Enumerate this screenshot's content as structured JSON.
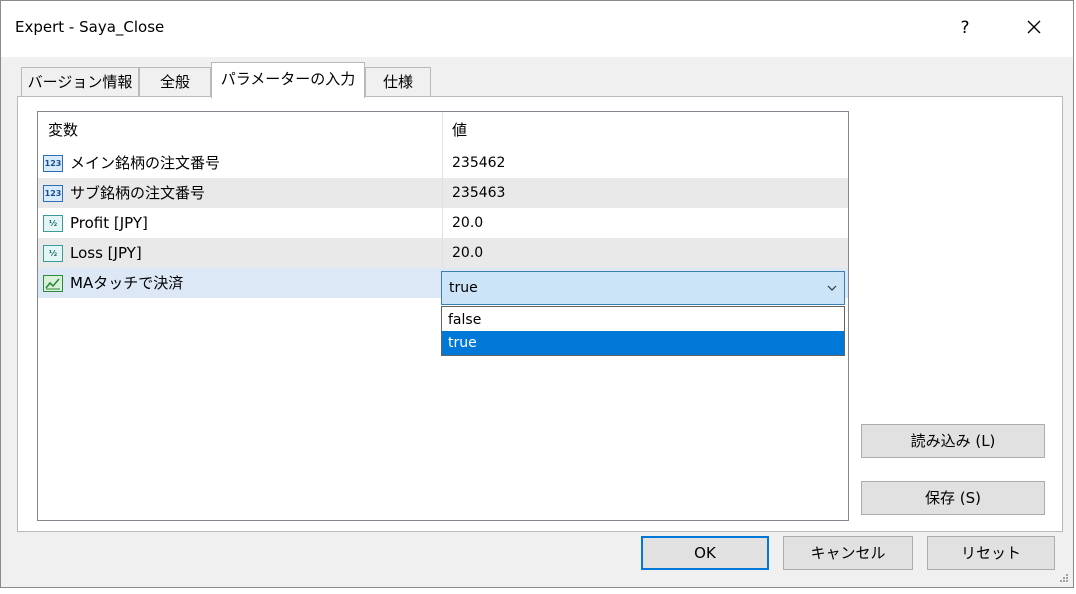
{
  "window": {
    "title": "Expert - Saya_Close",
    "help_label": "?",
    "close_label": "✕"
  },
  "tabs": [
    {
      "label": "バージョン情報"
    },
    {
      "label": "全般"
    },
    {
      "label": "パラメーターの入力"
    },
    {
      "label": "仕様"
    }
  ],
  "active_tab": "パラメーターの入力",
  "grid": {
    "headers": {
      "variable": "変数",
      "value": "値"
    },
    "rows": [
      {
        "icon": "123",
        "name": "メイン銘柄の注文番号",
        "value": "235462"
      },
      {
        "icon": "123",
        "name": "サブ銘柄の注文番号",
        "value": "235463"
      },
      {
        "icon": "½",
        "name": "Profit [JPY]",
        "value": "20.0"
      },
      {
        "icon": "½",
        "name": "Loss [JPY]",
        "value": "20.0"
      },
      {
        "icon": "bool-icon",
        "name": "MAタッチで決済",
        "value": "true"
      }
    ]
  },
  "combo": {
    "value": "true",
    "options": [
      "false",
      "true"
    ],
    "highlighted": "true"
  },
  "side_buttons": {
    "load_label": "読み込み (L)",
    "save_label": "保存 (S)"
  },
  "footer_buttons": {
    "ok_label": "OK",
    "cancel_label": "キャンセル",
    "reset_label": "リセット"
  },
  "colors": {
    "accent": "#0078d7",
    "selected_row": "#dde8f6",
    "alt_row": "#e9e9e9"
  }
}
